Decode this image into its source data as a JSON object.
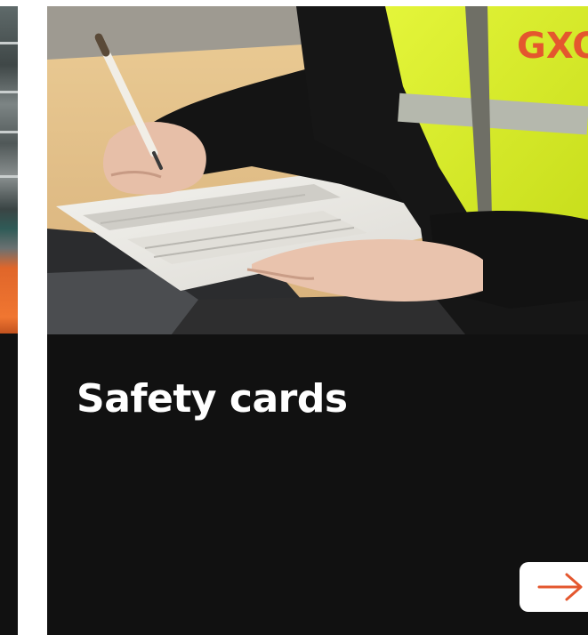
{
  "card": {
    "title": "Safety cards",
    "vest_logo": "GXO",
    "link_icon": "arrow-right-icon"
  },
  "colors": {
    "card_background": "#111111",
    "title_text": "#ffffff",
    "arrow_accent": "#e4572e",
    "vest_yellow": "#d9f02a",
    "logo_orange": "#e4572e"
  }
}
